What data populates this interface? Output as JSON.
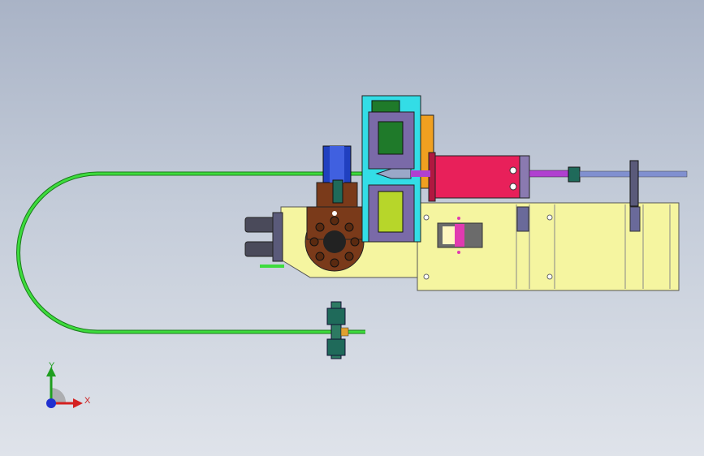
{
  "viewport": {
    "background_top": "#a9b3c6",
    "background_bottom": "#dfe3ea"
  },
  "triad": {
    "x_label": "X",
    "y_label": "Y",
    "x_color": "#d42020",
    "y_color": "#1f9e1f",
    "z_color": "#2030d0"
  },
  "colors": {
    "tube": "#3ddc3d",
    "base_yellow": "#f5f5a0",
    "motor_red": "#e8205a",
    "frame_cyan": "#33dde6",
    "block_purple": "#7a6aa8",
    "block_green": "#1f7a2a",
    "block_lime": "#b7d62a",
    "orange": "#f0a020",
    "brown_block": "#7a3a1a",
    "blue_block": "#2040c0",
    "dark_teal": "#1f6a5a",
    "shaft_violet": "#b040d0",
    "shaft_blue": "#8090d0"
  }
}
